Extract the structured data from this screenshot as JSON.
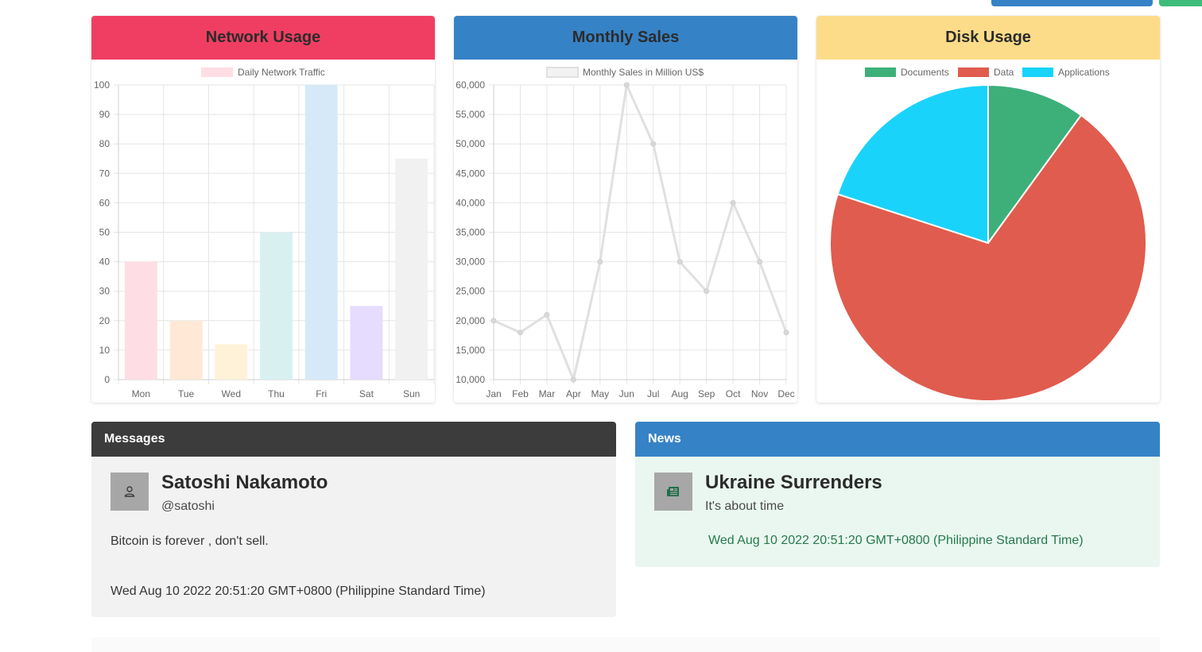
{
  "cards": {
    "network": {
      "title": "Network Usage",
      "header_color": "#f03e62"
    },
    "sales": {
      "title": "Monthly Sales",
      "header_color": "#3682c6"
    },
    "disk": {
      "title": "Disk Usage",
      "header_color": "#fddc89"
    }
  },
  "chart_data": [
    {
      "type": "bar",
      "legend": "Daily Network Traffic",
      "categories": [
        "Mon",
        "Tue",
        "Wed",
        "Thu",
        "Fri",
        "Sat",
        "Sun"
      ],
      "values": [
        40,
        20,
        12,
        50,
        100,
        25,
        75
      ],
      "ylim": [
        0,
        100
      ],
      "yticks": [
        "100",
        "90",
        "80",
        "70",
        "60",
        "50",
        "40",
        "30",
        "20",
        "10",
        "0"
      ],
      "colors": [
        "#ffdde4",
        "#ffe9d6",
        "#fff2d8",
        "#d9f0f0",
        "#d6e9f8",
        "#e6dcfd",
        "#f0f1f0"
      ],
      "grid": true
    },
    {
      "type": "line",
      "legend": "Monthly Sales in Million US$",
      "categories": [
        "Jan",
        "Feb",
        "Mar",
        "Apr",
        "May",
        "Jun",
        "Jul",
        "Aug",
        "Sep",
        "Oct",
        "Nov",
        "Dec"
      ],
      "values": [
        20000,
        18000,
        21000,
        10000,
        30000,
        60000,
        50000,
        30000,
        25000,
        40000,
        30000,
        18000
      ],
      "ylim": [
        10000,
        60000
      ],
      "yticks": [
        "60,000",
        "55,000",
        "50,000",
        "45,000",
        "40,000",
        "35,000",
        "30,000",
        "25,000",
        "20,000",
        "15,000",
        "10,000"
      ],
      "color": "#e0e0e0",
      "grid": true
    },
    {
      "type": "pie",
      "labels": [
        "Documents",
        "Data",
        "Applications"
      ],
      "values": [
        10,
        70,
        20
      ],
      "colors": [
        "#3db07a",
        "#e05c4e",
        "#1ad3fb"
      ]
    }
  ],
  "messages": {
    "header": "Messages",
    "header_color": "#3c3c3c",
    "name": "Satoshi Nakamoto",
    "handle": "@satoshi",
    "text": "Bitcoin is forever , don't sell.",
    "timestamp": "Wed Aug 10 2022 20:51:20 GMT+0800 (Philippine Standard Time)",
    "icon": "user-icon"
  },
  "news": {
    "header": "News",
    "header_color": "#3682c6",
    "title": "Ukraine Surrenders",
    "subtitle": "It's about time",
    "timestamp": "Wed Aug 10 2022 20:51:20 GMT+0800 (Philippine Standard Time)",
    "icon": "newspaper-icon"
  }
}
